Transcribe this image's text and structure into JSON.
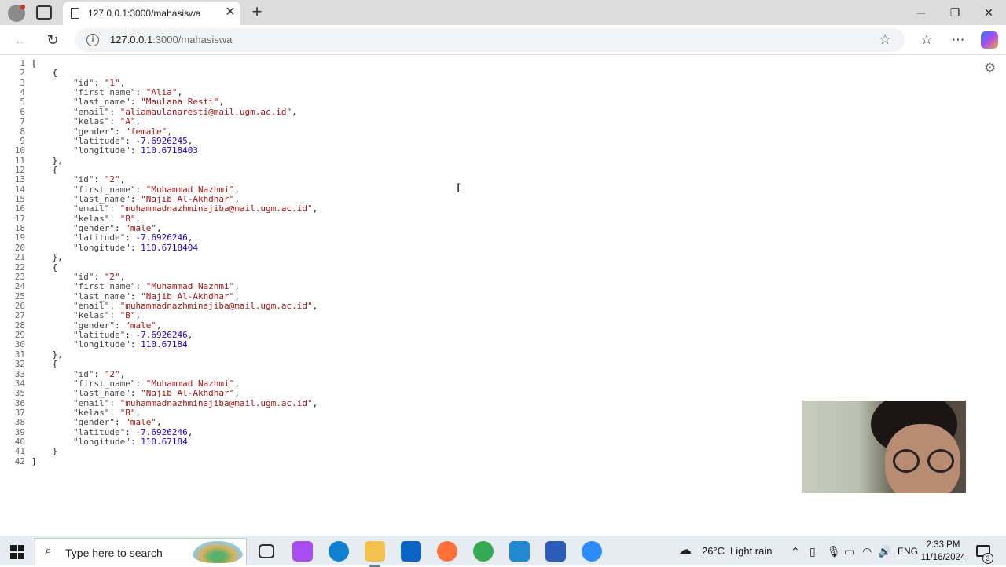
{
  "browser": {
    "tab_title": "127.0.0.1:3000/mahasiswa",
    "url_host": "127.0.0.1",
    "url_path": ":3000/mahasiswa"
  },
  "json_view": {
    "lines": [
      [
        {
          "t": "p",
          "v": "["
        }
      ],
      [
        {
          "t": "p",
          "v": "    {"
        }
      ],
      [
        {
          "t": "p",
          "v": "        "
        },
        {
          "t": "k",
          "v": "\"id\""
        },
        {
          "t": "p",
          "v": ": "
        },
        {
          "t": "s",
          "v": "\"1\""
        },
        {
          "t": "p",
          "v": ","
        }
      ],
      [
        {
          "t": "p",
          "v": "        "
        },
        {
          "t": "k",
          "v": "\"first_name\""
        },
        {
          "t": "p",
          "v": ": "
        },
        {
          "t": "s",
          "v": "\"Alia\""
        },
        {
          "t": "p",
          "v": ","
        }
      ],
      [
        {
          "t": "p",
          "v": "        "
        },
        {
          "t": "k",
          "v": "\"last_name\""
        },
        {
          "t": "p",
          "v": ": "
        },
        {
          "t": "s",
          "v": "\"Maulana Resti\""
        },
        {
          "t": "p",
          "v": ","
        }
      ],
      [
        {
          "t": "p",
          "v": "        "
        },
        {
          "t": "k",
          "v": "\"email\""
        },
        {
          "t": "p",
          "v": ": "
        },
        {
          "t": "s",
          "v": "\"aliamaulanaresti@mail.ugm.ac.id\""
        },
        {
          "t": "p",
          "v": ","
        }
      ],
      [
        {
          "t": "p",
          "v": "        "
        },
        {
          "t": "k",
          "v": "\"kelas\""
        },
        {
          "t": "p",
          "v": ": "
        },
        {
          "t": "s",
          "v": "\"A\""
        },
        {
          "t": "p",
          "v": ","
        }
      ],
      [
        {
          "t": "p",
          "v": "        "
        },
        {
          "t": "k",
          "v": "\"gender\""
        },
        {
          "t": "p",
          "v": ": "
        },
        {
          "t": "s",
          "v": "\"female\""
        },
        {
          "t": "p",
          "v": ","
        }
      ],
      [
        {
          "t": "p",
          "v": "        "
        },
        {
          "t": "k",
          "v": "\"latitude\""
        },
        {
          "t": "p",
          "v": ": "
        },
        {
          "t": "n",
          "v": "-7.6926245"
        },
        {
          "t": "p",
          "v": ","
        }
      ],
      [
        {
          "t": "p",
          "v": "        "
        },
        {
          "t": "k",
          "v": "\"longitude\""
        },
        {
          "t": "p",
          "v": ": "
        },
        {
          "t": "n",
          "v": "110.6718403"
        }
      ],
      [
        {
          "t": "p",
          "v": "    },"
        }
      ],
      [
        {
          "t": "p",
          "v": "    {"
        }
      ],
      [
        {
          "t": "p",
          "v": "        "
        },
        {
          "t": "k",
          "v": "\"id\""
        },
        {
          "t": "p",
          "v": ": "
        },
        {
          "t": "s",
          "v": "\"2\""
        },
        {
          "t": "p",
          "v": ","
        }
      ],
      [
        {
          "t": "p",
          "v": "        "
        },
        {
          "t": "k",
          "v": "\"first_name\""
        },
        {
          "t": "p",
          "v": ": "
        },
        {
          "t": "s",
          "v": "\"Muhammad Nazhmi\""
        },
        {
          "t": "p",
          "v": ","
        }
      ],
      [
        {
          "t": "p",
          "v": "        "
        },
        {
          "t": "k",
          "v": "\"last_name\""
        },
        {
          "t": "p",
          "v": ": "
        },
        {
          "t": "s",
          "v": "\"Najib Al-Akhdhar\""
        },
        {
          "t": "p",
          "v": ","
        }
      ],
      [
        {
          "t": "p",
          "v": "        "
        },
        {
          "t": "k",
          "v": "\"email\""
        },
        {
          "t": "p",
          "v": ": "
        },
        {
          "t": "s",
          "v": "\"muhammadnazhminajiba@mail.ugm.ac.id\""
        },
        {
          "t": "p",
          "v": ","
        }
      ],
      [
        {
          "t": "p",
          "v": "        "
        },
        {
          "t": "k",
          "v": "\"kelas\""
        },
        {
          "t": "p",
          "v": ": "
        },
        {
          "t": "s",
          "v": "\"B\""
        },
        {
          "t": "p",
          "v": ","
        }
      ],
      [
        {
          "t": "p",
          "v": "        "
        },
        {
          "t": "k",
          "v": "\"gender\""
        },
        {
          "t": "p",
          "v": ": "
        },
        {
          "t": "s",
          "v": "\"male\""
        },
        {
          "t": "p",
          "v": ","
        }
      ],
      [
        {
          "t": "p",
          "v": "        "
        },
        {
          "t": "k",
          "v": "\"latitude\""
        },
        {
          "t": "p",
          "v": ": "
        },
        {
          "t": "n",
          "v": "-7.6926246"
        },
        {
          "t": "p",
          "v": ","
        }
      ],
      [
        {
          "t": "p",
          "v": "        "
        },
        {
          "t": "k",
          "v": "\"longitude\""
        },
        {
          "t": "p",
          "v": ": "
        },
        {
          "t": "n",
          "v": "110.6718404"
        }
      ],
      [
        {
          "t": "p",
          "v": "    },"
        }
      ],
      [
        {
          "t": "p",
          "v": "    {"
        }
      ],
      [
        {
          "t": "p",
          "v": "        "
        },
        {
          "t": "k",
          "v": "\"id\""
        },
        {
          "t": "p",
          "v": ": "
        },
        {
          "t": "s",
          "v": "\"2\""
        },
        {
          "t": "p",
          "v": ","
        }
      ],
      [
        {
          "t": "p",
          "v": "        "
        },
        {
          "t": "k",
          "v": "\"first_name\""
        },
        {
          "t": "p",
          "v": ": "
        },
        {
          "t": "s",
          "v": "\"Muhammad Nazhmi\""
        },
        {
          "t": "p",
          "v": ","
        }
      ],
      [
        {
          "t": "p",
          "v": "        "
        },
        {
          "t": "k",
          "v": "\"last_name\""
        },
        {
          "t": "p",
          "v": ": "
        },
        {
          "t": "s",
          "v": "\"Najib Al-Akhdhar\""
        },
        {
          "t": "p",
          "v": ","
        }
      ],
      [
        {
          "t": "p",
          "v": "        "
        },
        {
          "t": "k",
          "v": "\"email\""
        },
        {
          "t": "p",
          "v": ": "
        },
        {
          "t": "s",
          "v": "\"muhammadnazhminajiba@mail.ugm.ac.id\""
        },
        {
          "t": "p",
          "v": ","
        }
      ],
      [
        {
          "t": "p",
          "v": "        "
        },
        {
          "t": "k",
          "v": "\"kelas\""
        },
        {
          "t": "p",
          "v": ": "
        },
        {
          "t": "s",
          "v": "\"B\""
        },
        {
          "t": "p",
          "v": ","
        }
      ],
      [
        {
          "t": "p",
          "v": "        "
        },
        {
          "t": "k",
          "v": "\"gender\""
        },
        {
          "t": "p",
          "v": ": "
        },
        {
          "t": "s",
          "v": "\"male\""
        },
        {
          "t": "p",
          "v": ","
        }
      ],
      [
        {
          "t": "p",
          "v": "        "
        },
        {
          "t": "k",
          "v": "\"latitude\""
        },
        {
          "t": "p",
          "v": ": "
        },
        {
          "t": "n",
          "v": "-7.6926246"
        },
        {
          "t": "p",
          "v": ","
        }
      ],
      [
        {
          "t": "p",
          "v": "        "
        },
        {
          "t": "k",
          "v": "\"longitude\""
        },
        {
          "t": "p",
          "v": ": "
        },
        {
          "t": "n",
          "v": "110.67184"
        }
      ],
      [
        {
          "t": "p",
          "v": "    },"
        }
      ],
      [
        {
          "t": "p",
          "v": "    {"
        }
      ],
      [
        {
          "t": "p",
          "v": "        "
        },
        {
          "t": "k",
          "v": "\"id\""
        },
        {
          "t": "p",
          "v": ": "
        },
        {
          "t": "s",
          "v": "\"2\""
        },
        {
          "t": "p",
          "v": ","
        }
      ],
      [
        {
          "t": "p",
          "v": "        "
        },
        {
          "t": "k",
          "v": "\"first_name\""
        },
        {
          "t": "p",
          "v": ": "
        },
        {
          "t": "s",
          "v": "\"Muhammad Nazhmi\""
        },
        {
          "t": "p",
          "v": ","
        }
      ],
      [
        {
          "t": "p",
          "v": "        "
        },
        {
          "t": "k",
          "v": "\"last_name\""
        },
        {
          "t": "p",
          "v": ": "
        },
        {
          "t": "s",
          "v": "\"Najib Al-Akhdhar\""
        },
        {
          "t": "p",
          "v": ","
        }
      ],
      [
        {
          "t": "p",
          "v": "        "
        },
        {
          "t": "k",
          "v": "\"email\""
        },
        {
          "t": "p",
          "v": ": "
        },
        {
          "t": "s",
          "v": "\"muhammadnazhminajiba@mail.ugm.ac.id\""
        },
        {
          "t": "p",
          "v": ","
        }
      ],
      [
        {
          "t": "p",
          "v": "        "
        },
        {
          "t": "k",
          "v": "\"kelas\""
        },
        {
          "t": "p",
          "v": ": "
        },
        {
          "t": "s",
          "v": "\"B\""
        },
        {
          "t": "p",
          "v": ","
        }
      ],
      [
        {
          "t": "p",
          "v": "        "
        },
        {
          "t": "k",
          "v": "\"gender\""
        },
        {
          "t": "p",
          "v": ": "
        },
        {
          "t": "s",
          "v": "\"male\""
        },
        {
          "t": "p",
          "v": ","
        }
      ],
      [
        {
          "t": "p",
          "v": "        "
        },
        {
          "t": "k",
          "v": "\"latitude\""
        },
        {
          "t": "p",
          "v": ": "
        },
        {
          "t": "n",
          "v": "-7.6926246"
        },
        {
          "t": "p",
          "v": ","
        }
      ],
      [
        {
          "t": "p",
          "v": "        "
        },
        {
          "t": "k",
          "v": "\"longitude\""
        },
        {
          "t": "p",
          "v": ": "
        },
        {
          "t": "n",
          "v": "110.67184"
        }
      ],
      [
        {
          "t": "p",
          "v": "    }"
        }
      ],
      [
        {
          "t": "p",
          "v": "]"
        }
      ]
    ]
  },
  "taskbar": {
    "search_placeholder": "Type here to search",
    "weather_temp": "26°C",
    "weather_desc": "Light rain",
    "language": "ENG",
    "time": "2:33 PM",
    "date": "11/16/2024",
    "notification_count": "3",
    "apps": [
      {
        "icon": "task-view-icon",
        "color": "#2b2b2b"
      },
      {
        "icon": "copilot-icon",
        "color": "#a94cf0"
      },
      {
        "icon": "edge-icon",
        "color": "#0f7fd0"
      },
      {
        "icon": "file-explorer-icon",
        "color": "#f2c14e"
      },
      {
        "icon": "outlook-icon",
        "color": "#0a64c2"
      },
      {
        "icon": "firefox-icon",
        "color": "#ff7139"
      },
      {
        "icon": "chrome-icon",
        "color": "#34a853"
      },
      {
        "icon": "vscode-icon",
        "color": "#1f8ad2"
      },
      {
        "icon": "word-icon",
        "color": "#2b5cb8"
      },
      {
        "icon": "zoom-icon",
        "color": "#2d8cff"
      }
    ]
  },
  "colors": {
    "json_string": "#a31515",
    "json_number": "#1c00cf",
    "taskbar_bg": "#e6ecf2"
  }
}
